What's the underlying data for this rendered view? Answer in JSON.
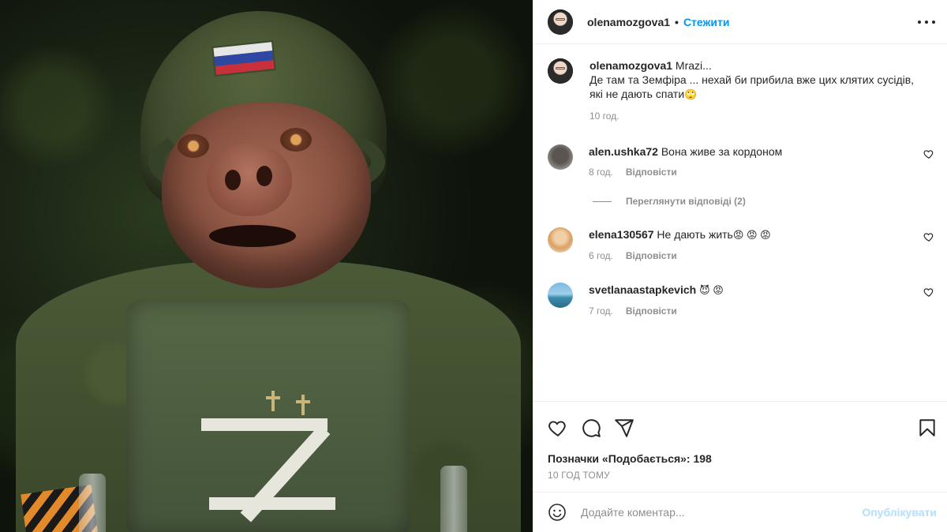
{
  "header": {
    "username": "olenamozgova1",
    "separator": "•",
    "follow_label": "Стежити"
  },
  "caption": {
    "username": "olenamozgova1",
    "text_line1": "Mrazi...",
    "text_line2": "Де там та Земфіра ... нехай би прибила вже цих клятих сусідів,",
    "text_line3": "які не дають спати",
    "emoji": "🙄",
    "time": "10 год."
  },
  "comments": [
    {
      "username": "alen.ushka72",
      "text": "Вона живе за кордоном",
      "emoji": "",
      "time": "8 год.",
      "reply_label": "Відповісти"
    },
    {
      "username": "elena130567",
      "text": "Не дають жить",
      "emoji": "😡 😡 😡",
      "time": "6 год.",
      "reply_label": "Відповісти"
    },
    {
      "username": "svetlanaastapkevich",
      "text": "",
      "emoji": "😈 😡",
      "time": "7 год.",
      "reply_label": "Відповісти"
    }
  ],
  "view_replies": "Переглянути відповіді (2)",
  "likes": "Позначки «Подобається»: 198",
  "time_ago": "10 ГОД ТОМУ",
  "add_comment": {
    "placeholder": "Додайте коментар...",
    "publish_label": "Опублікувати"
  },
  "icons": {
    "more": "more-options-icon",
    "like": "heart-icon",
    "comment": "comment-icon",
    "share": "share-icon",
    "save": "bookmark-icon",
    "emoji": "emoji-icon"
  },
  "colors": {
    "link_blue": "#0095f6",
    "publish_disabled": "#b2dffc",
    "secondary_text": "#8e8e8e"
  }
}
